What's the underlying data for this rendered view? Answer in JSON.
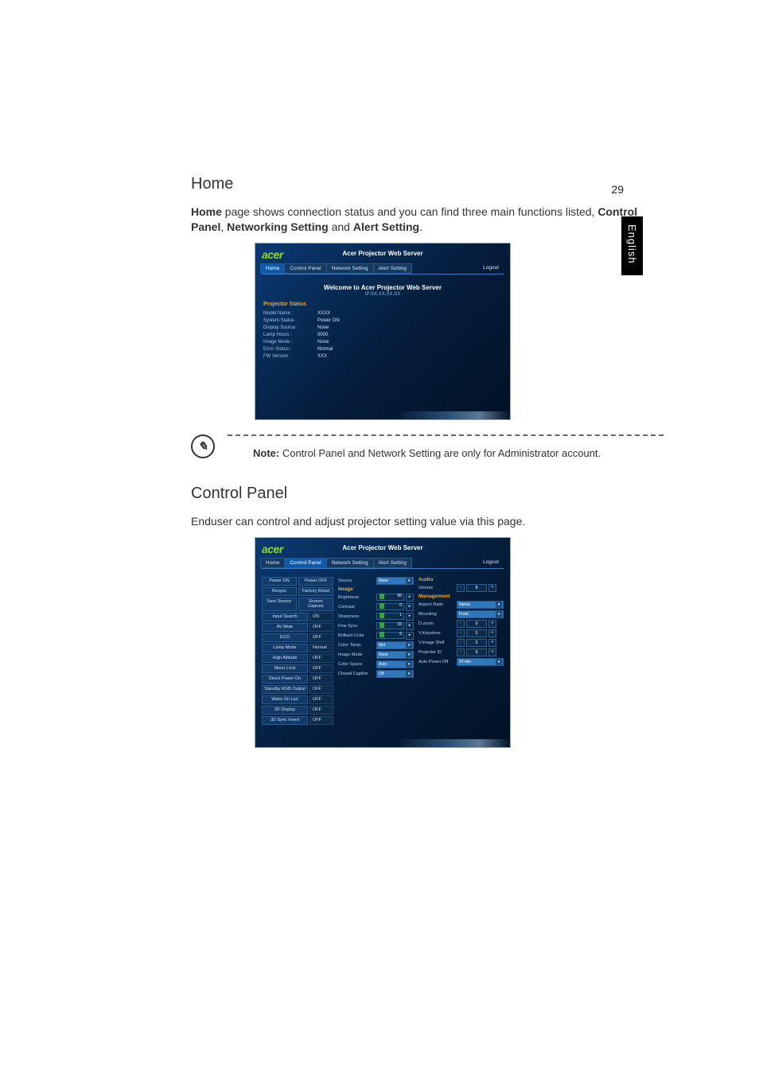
{
  "page_number": "29",
  "side_tab": "English",
  "home": {
    "title": "Home",
    "para_before": "Home",
    "para_mid": " page shows connection status and you can find three main functions listed, ",
    "cp": "Control Panel",
    "sep1": ", ",
    "ns": "Networking Setting",
    "sep2": " and ",
    "as": "Alert Setting",
    "end": "."
  },
  "ss1": {
    "logo": "acer",
    "title": "Acer Projector Web Server",
    "tabs": [
      "Home",
      "Control Panel",
      "Network Setting",
      "Alert Setting"
    ],
    "logout": "Logout",
    "welcome": "Welcome to Acer Projector Web Server",
    "ip": "IP:XX.XX.XX.XX",
    "status_hd": "Projector Status",
    "rows": [
      {
        "k": "Model Name :",
        "v": "XXXX"
      },
      {
        "k": "System Status :",
        "v": "Power ON"
      },
      {
        "k": "Display Source :",
        "v": "None"
      },
      {
        "k": "Lamp Hours :",
        "v": "0000"
      },
      {
        "k": "Image Mode :",
        "v": "None"
      },
      {
        "k": "Error Status :",
        "v": "Normal"
      },
      {
        "k": "FW Version :",
        "v": "XXX"
      }
    ]
  },
  "note": {
    "prefix": "Note:",
    "text": " Control Panel and Network Setting are only for Administrator account."
  },
  "cp_section": {
    "title": "Control Panel",
    "para": "Enduser can control and adjust projector setting value via this page."
  },
  "ss2": {
    "logo": "acer",
    "title": "Acer Projector Web Server",
    "tabs": [
      "Home",
      "Control Panel",
      "Network Setting",
      "Alert Setting"
    ],
    "logout": "Logout",
    "left_buttons": [
      [
        "Power ON",
        "Power OFF"
      ],
      [
        "Resync",
        "Factory Reset"
      ],
      [
        "Next Source",
        "Screen Capture"
      ]
    ],
    "left_states": [
      {
        "label": "Input Search",
        "state": "ON"
      },
      {
        "label": "AV Mute",
        "state": "OFF"
      },
      {
        "label": "ECO",
        "state": "OFF"
      },
      {
        "label": "Lamp Mode",
        "state": "Normal"
      },
      {
        "label": "High Altitude",
        "state": "OFF"
      },
      {
        "label": "Menu Lock",
        "state": "OFF"
      },
      {
        "label": "Direct Power On",
        "state": "OFF"
      },
      {
        "label": "Standby RGB Output",
        "state": "OFF"
      },
      {
        "label": "Wake On Lan",
        "state": "OFF"
      },
      {
        "label": "3D Display",
        "state": "OFF"
      },
      {
        "label": "3D Sync Invert",
        "state": "OFF"
      }
    ],
    "mid": {
      "source_lbl": "Source",
      "source_val": "None",
      "image_hd": "Image",
      "sliders": [
        {
          "label": "Brightness",
          "val": "50"
        },
        {
          "label": "Contrast",
          "val": "0"
        },
        {
          "label": "Sharpness",
          "val": "1"
        },
        {
          "label": "Fine Sync",
          "val": "15"
        },
        {
          "label": "Brilliant Color",
          "val": "6"
        }
      ],
      "selects": [
        {
          "label": "Color Temp.",
          "val": "Mid"
        },
        {
          "label": "Image Mode",
          "val": "None"
        },
        {
          "label": "Color Space",
          "val": "Auto"
        },
        {
          "label": "Closed Caption",
          "val": "Off"
        }
      ]
    },
    "right": {
      "audio_hd": "Audio",
      "volume": {
        "label": "Volume",
        "val": "8"
      },
      "mgmt_hd": "Management",
      "aspect": {
        "label": "Aspect Ratio",
        "val": "Native"
      },
      "mount": {
        "label": "Mounting",
        "val": "Front"
      },
      "dzoom": {
        "label": "D.zoom",
        "val": "0"
      },
      "vkey": {
        "label": "V.Keystone",
        "val": "0"
      },
      "vshift": {
        "label": "V.Image Shift",
        "val": "0"
      },
      "projid": {
        "label": "Projector ID",
        "val": "0"
      },
      "autopwr": {
        "label": "Auto Power Off",
        "val": "20 min"
      }
    }
  }
}
